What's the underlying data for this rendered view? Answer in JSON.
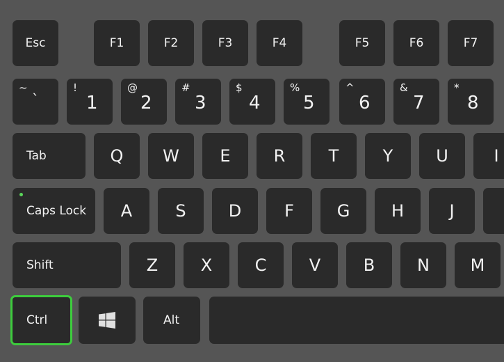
{
  "highlight_color": "#3dcc3d",
  "function_row": [
    "Esc",
    "F1",
    "F2",
    "F3",
    "F4",
    "F5",
    "F6",
    "F7"
  ],
  "number_row": [
    {
      "shift": "~",
      "main": "`"
    },
    {
      "shift": "!",
      "main": "1"
    },
    {
      "shift": "@",
      "main": "2"
    },
    {
      "shift": "#",
      "main": "3"
    },
    {
      "shift": "$",
      "main": "4"
    },
    {
      "shift": "%",
      "main": "5"
    },
    {
      "shift": "^",
      "main": "6"
    },
    {
      "shift": "&",
      "main": "7"
    },
    {
      "shift": "*",
      "main": "8"
    }
  ],
  "qwerty_row": [
    "Tab",
    "Q",
    "W",
    "E",
    "R",
    "T",
    "Y",
    "U",
    "I"
  ],
  "home_row": [
    "Caps Lock",
    "A",
    "S",
    "D",
    "F",
    "G",
    "H",
    "J"
  ],
  "shift_row": [
    "Shift",
    "Z",
    "X",
    "C",
    "V",
    "B",
    "N",
    "M"
  ],
  "bottom_row": {
    "ctrl": "Ctrl",
    "windows_icon": "windows-logo",
    "alt": "Alt"
  }
}
